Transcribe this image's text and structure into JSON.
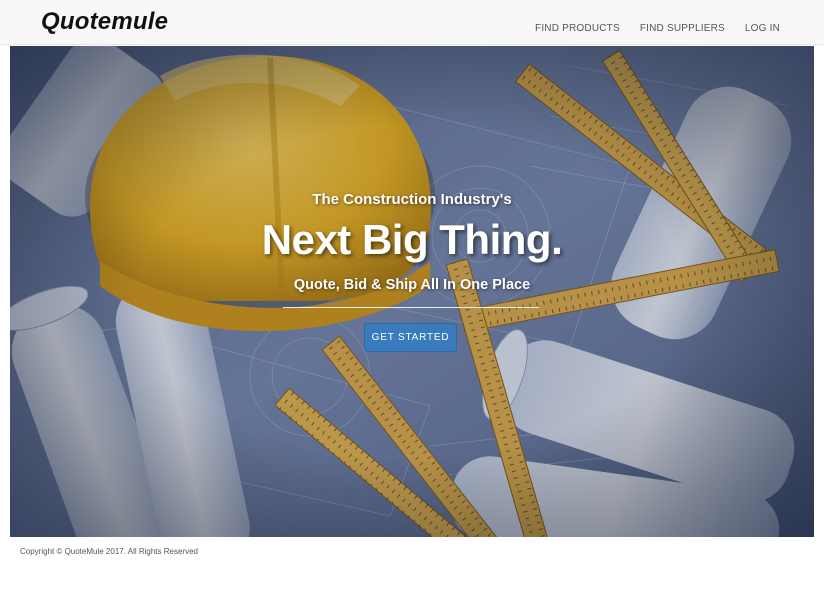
{
  "navbar": {
    "brand": "Quotemule",
    "links": [
      "FIND PRODUCTS",
      "FIND SUPPLIERS",
      "LOG IN"
    ]
  },
  "hero": {
    "tagline": "The Construction Industry's",
    "headline": "Next Big Thing.",
    "subline": "Quote, Bid & Ship All In One Place",
    "cta_label": "GET STARTED"
  },
  "footer": {
    "copyright": "Copyright © QuoteMule 2017. All Rights Reserved"
  },
  "colors": {
    "navbar_bg": "#f8f8f8",
    "cta_bg": "#3a7bbd",
    "hardhat": "#f2b81e",
    "ruler": "#e2b04a",
    "blueprint": "#8a9cc4"
  }
}
